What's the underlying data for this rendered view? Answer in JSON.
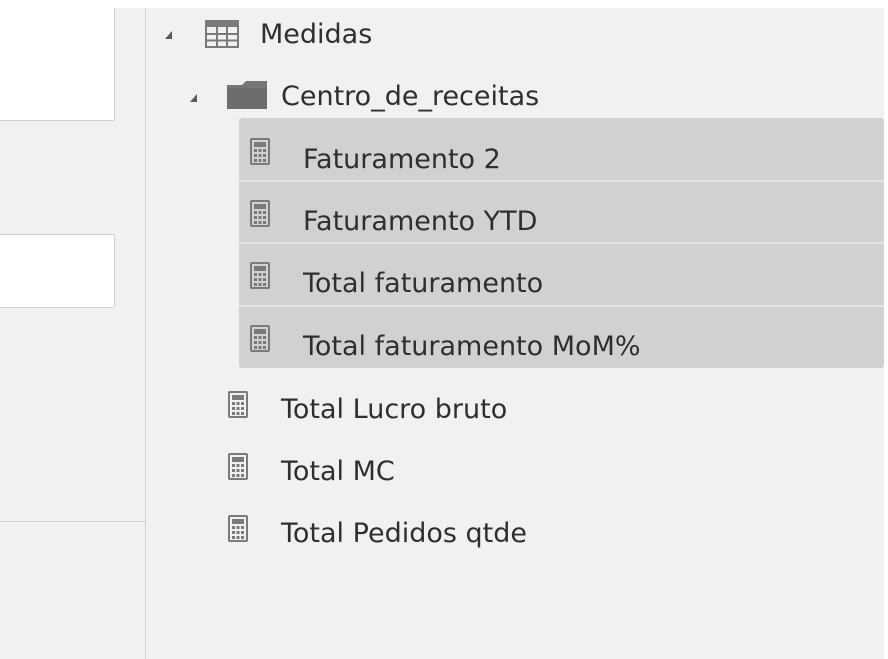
{
  "tree": {
    "table": {
      "label": "Medidas",
      "icon": "table-icon",
      "expanded": true
    },
    "folder": {
      "label": "Centro_de_receitas",
      "icon": "folder-icon",
      "expanded": true,
      "measures": [
        {
          "label": "Faturamento 2",
          "selected": true
        },
        {
          "label": "Faturamento YTD",
          "selected": true
        },
        {
          "label": "Total faturamento",
          "selected": true
        },
        {
          "label": "Total faturamento MoM%",
          "selected": true
        }
      ]
    },
    "measures": [
      {
        "label": "Total Lucro bruto"
      },
      {
        "label": "Total MC"
      },
      {
        "label": "Total Pedidos qtde"
      }
    ]
  },
  "colors": {
    "pane_bg": "#f2f1f0",
    "selection_bg": "#d2d1d0",
    "text": "#2f2f2f",
    "icon": "#7a7a7a"
  }
}
